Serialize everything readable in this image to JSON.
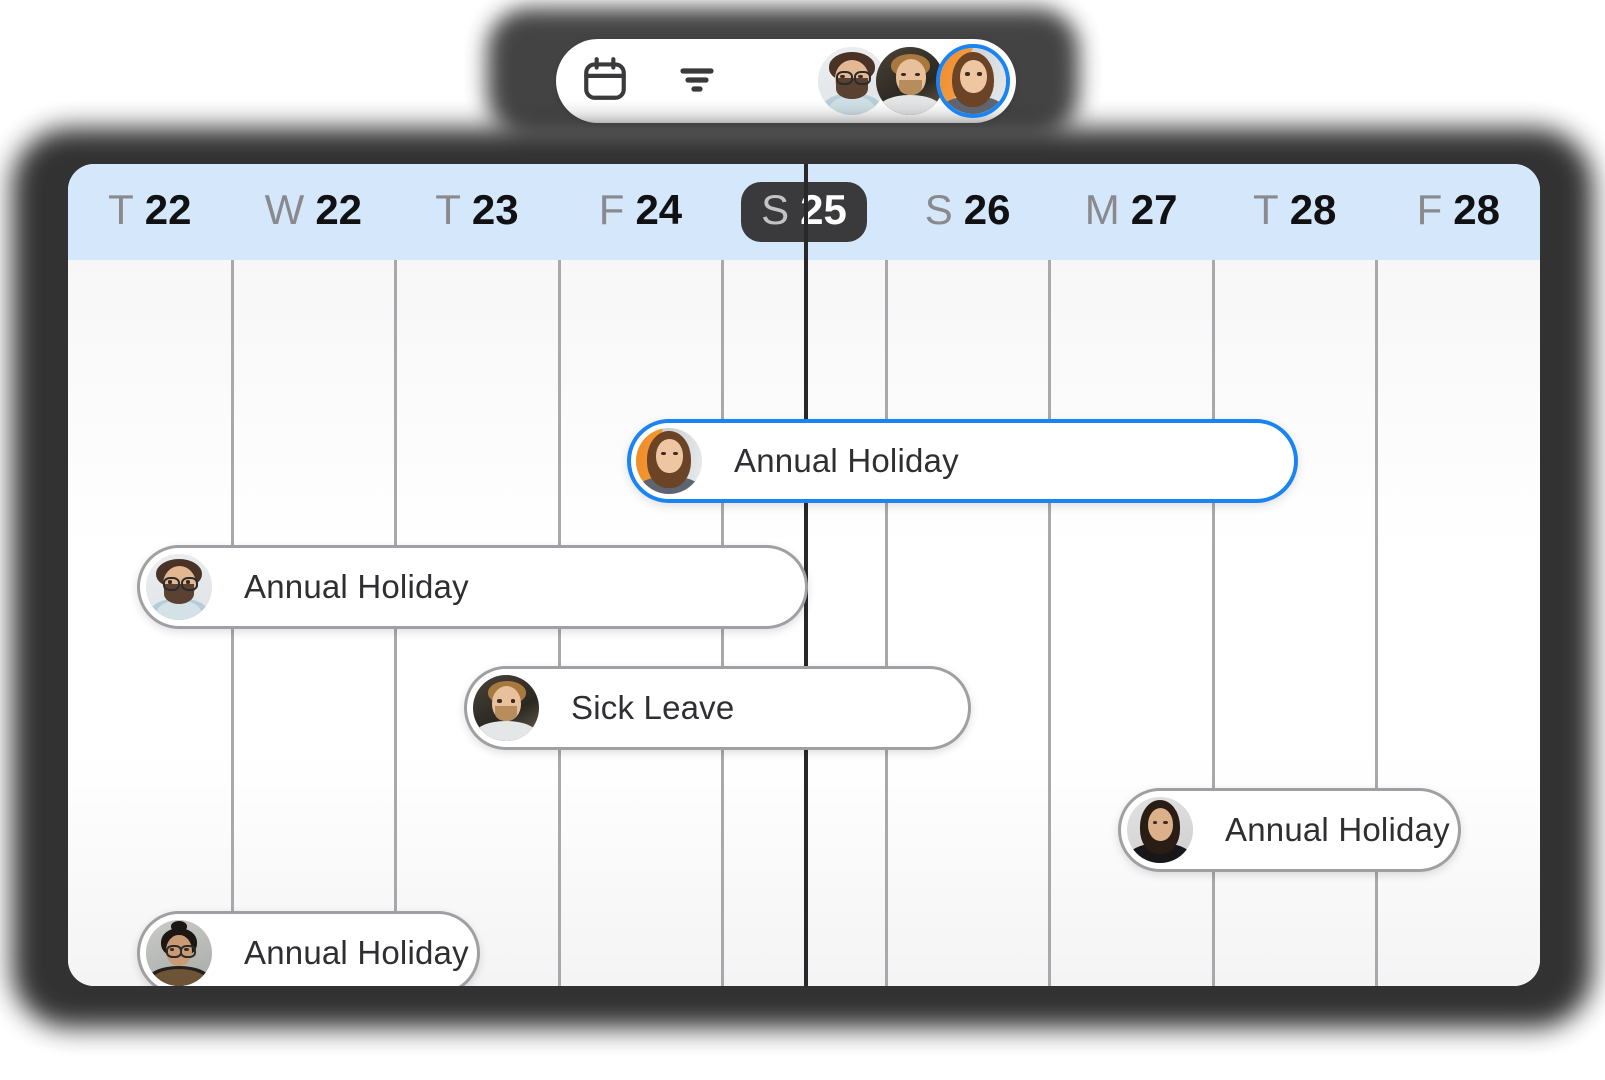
{
  "toolbar": {
    "calendar_icon": "calendar-icon",
    "calendar_label": "Calendar view",
    "filter_icon": "filter-icon",
    "filter_label": "Filter",
    "avatars": [
      {
        "name": "Curly-haired man with glasses",
        "selected": false
      },
      {
        "name": "Blond man in white shirt",
        "selected": false
      },
      {
        "name": "Woman with long brown hair",
        "selected": true
      }
    ]
  },
  "calendar": {
    "accent_color": "#1a84f2",
    "header_bg": "#d4e7fb",
    "today_pill_bg": "#3a3a3c",
    "days": [
      {
        "dow": "T",
        "num": "22",
        "today": false
      },
      {
        "dow": "W",
        "num": "22",
        "today": false
      },
      {
        "dow": "T",
        "num": "23",
        "today": false
      },
      {
        "dow": "F",
        "num": "24",
        "today": false
      },
      {
        "dow": "S",
        "num": "25",
        "today": true
      },
      {
        "dow": "S",
        "num": "26",
        "today": false
      },
      {
        "dow": "M",
        "num": "27",
        "today": false
      },
      {
        "dow": "T",
        "num": "28",
        "today": false
      },
      {
        "dow": "F",
        "num": "28",
        "today": false
      }
    ],
    "now_marker_day": "S 25",
    "events": [
      {
        "title": "Annual Holiday",
        "avatar": "Woman with long brown hair",
        "selected": true,
        "start_day": "F 24",
        "end_day": "T 28"
      },
      {
        "title": "Annual Holiday",
        "avatar": "Curly-haired man with glasses",
        "selected": false,
        "start_day": "T 22",
        "end_day": "S 25"
      },
      {
        "title": "Sick Leave",
        "avatar": "Blond man in white shirt",
        "selected": false,
        "start_day": "T 23",
        "end_day": "S 26"
      },
      {
        "title": "Annual Holiday",
        "avatar": "Woman with dark hair in black top",
        "selected": false,
        "start_day": "M 27",
        "end_day": "F 28"
      },
      {
        "title": "Annual Holiday",
        "avatar": "Person with bun and glasses",
        "selected": false,
        "start_day": "T 22",
        "end_day": "T 23"
      }
    ]
  }
}
